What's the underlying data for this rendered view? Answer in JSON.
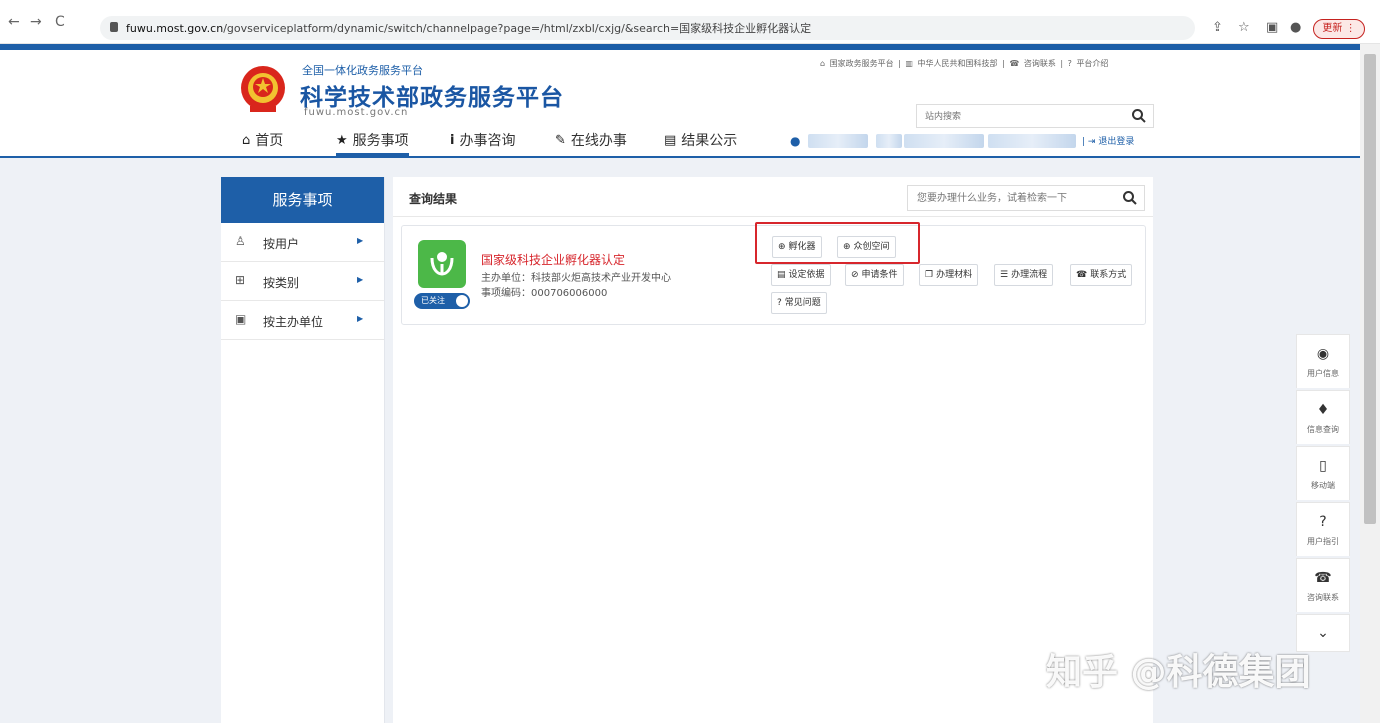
{
  "browser": {
    "url_host": "fuwu.most.gov.cn",
    "url_path": "/govserviceplatform/dynamic/switch/channelpage?page=/html/zxbl/cxjg/&search=国家级科技企业孵化器认定",
    "update_label": "更新"
  },
  "site": {
    "subtitle": "全国一体化政务服务平台",
    "title": "科学技术部政务服务平台",
    "domain": "fuwu.most.gov.cn",
    "top_links": [
      "国家政务服务平台",
      "中华人民共和国科技部",
      "咨询联系",
      "平台介绍"
    ],
    "search_placeholder": "站内搜索",
    "logout_label": "退出登录"
  },
  "nav": {
    "items": [
      {
        "label": "首页",
        "icon": "home-icon"
      },
      {
        "label": "服务事项",
        "icon": "star-icon"
      },
      {
        "label": "办事咨询",
        "icon": "info-icon"
      },
      {
        "label": "在线办事",
        "icon": "pencil-icon"
      },
      {
        "label": "结果公示",
        "icon": "book-icon"
      }
    ],
    "active": "服务事项"
  },
  "sidebar": {
    "title": "服务事项",
    "items": [
      {
        "label": "按用户",
        "icon": "user-icon"
      },
      {
        "label": "按类别",
        "icon": "grid-icon"
      },
      {
        "label": "按主办单位",
        "icon": "building-icon"
      }
    ]
  },
  "main": {
    "title": "查询结果",
    "search_placeholder": "您要办理什么业务，试着检索一下"
  },
  "result": {
    "title": "国家级科技企业孵化器认定",
    "host_unit": "主办单位：科技部火炬高技术产业开发中心",
    "item_code": "事项编码：000706006000",
    "follow_label": "已关注",
    "tags": [
      "孵化器",
      "众创空间"
    ],
    "actions": [
      "设定依据",
      "申请条件",
      "办理材料",
      "办理流程",
      "联系方式",
      "常见问题"
    ]
  },
  "right_rail": {
    "items": [
      "用户信息",
      "信息查询",
      "移动端",
      "用户指引",
      "咨询联系"
    ]
  },
  "watermark": "知乎 @科德集团",
  "colors": {
    "brand_blue": "#1e5fa8",
    "highlight_red": "#d7262c",
    "app_green": "#4cb848"
  }
}
